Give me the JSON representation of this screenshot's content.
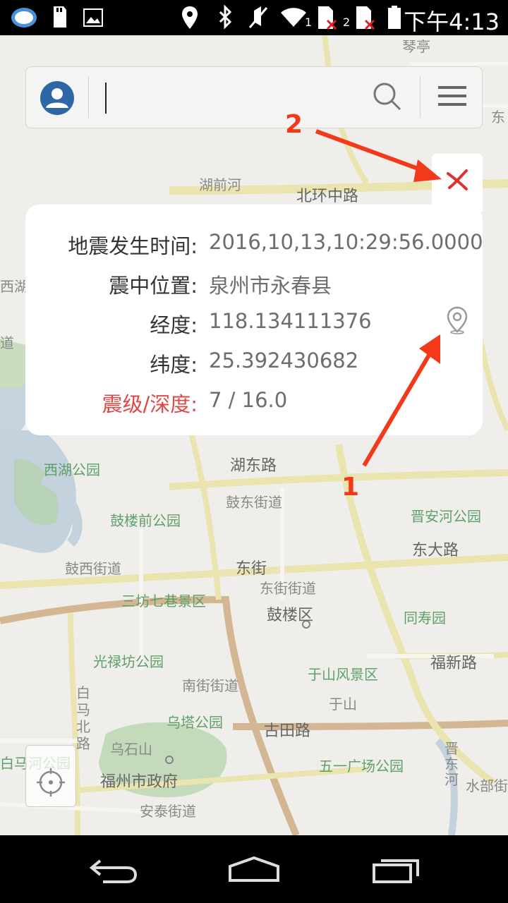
{
  "status_bar": {
    "time": "下午4:13",
    "sim1_label": "1",
    "sim2_label": "2",
    "icons": [
      "ifly-icon",
      "sd-card-icon",
      "image-icon",
      "location-icon",
      "bluetooth-icon",
      "mute-icon",
      "wifi-icon",
      "sim-card-icon",
      "battery-icon"
    ]
  },
  "search": {
    "placeholder": "",
    "value": ""
  },
  "popup": {
    "rows": [
      {
        "label": "地震发生时间:",
        "value": "2016,10,13,10:29:56.0000"
      },
      {
        "label": "震中位置:",
        "value": "泉州市永春县"
      },
      {
        "label": "经度:",
        "value": "118.134111376"
      },
      {
        "label": "纬度:",
        "value": "25.392430682"
      },
      {
        "label": "震级/深度:",
        "value": "7 / 16.0"
      }
    ],
    "highlight_color": "#e04848"
  },
  "annotations": {
    "arrow1_label": "1",
    "arrow2_label": "2",
    "color": "#f23a1a"
  },
  "map": {
    "labels": {
      "hubei_river": "湖前河",
      "beihuan_road": "北环中路",
      "xihu_park": "西湖公园",
      "hudong_road": "湖东路",
      "gudong_street": "鼓东街道",
      "gulouqian_park": "鼓楼前公园",
      "jinan_park": "晋安河公园",
      "dongda_road": "东大路",
      "guxi_street": "鼓西街道",
      "dongjie": "东街",
      "dongjie_street": "东街街道",
      "sanfang": "三坊七巷景区",
      "gulou_district": "鼓楼区",
      "tongshou_park": "同寿园",
      "guanglu_park": "光禄坊公园",
      "fuxin_road": "福新路",
      "nanjie_street": "南街街道",
      "yushan_scenic": "于山风景区",
      "yushan": "于山",
      "baima_north": "白马北路",
      "wuta_park": "乌塔公园",
      "gutian_road": "古田路",
      "wushi_mountain": "乌石山",
      "wuyi_park": "五一广场公园",
      "baima_river_park": "白马河公园",
      "city_gov": "福州市政府",
      "shuibu": "水部街",
      "antai_street": "安泰街道",
      "jindong_river": "晋东河",
      "xihe_road": "西河路",
      "dao": "道",
      "xihu_road": "西湖路",
      "top_road": "琴亭",
      "east_label": "东"
    }
  },
  "nav": {
    "icons": [
      "back-icon",
      "home-icon",
      "recents-icon"
    ]
  }
}
